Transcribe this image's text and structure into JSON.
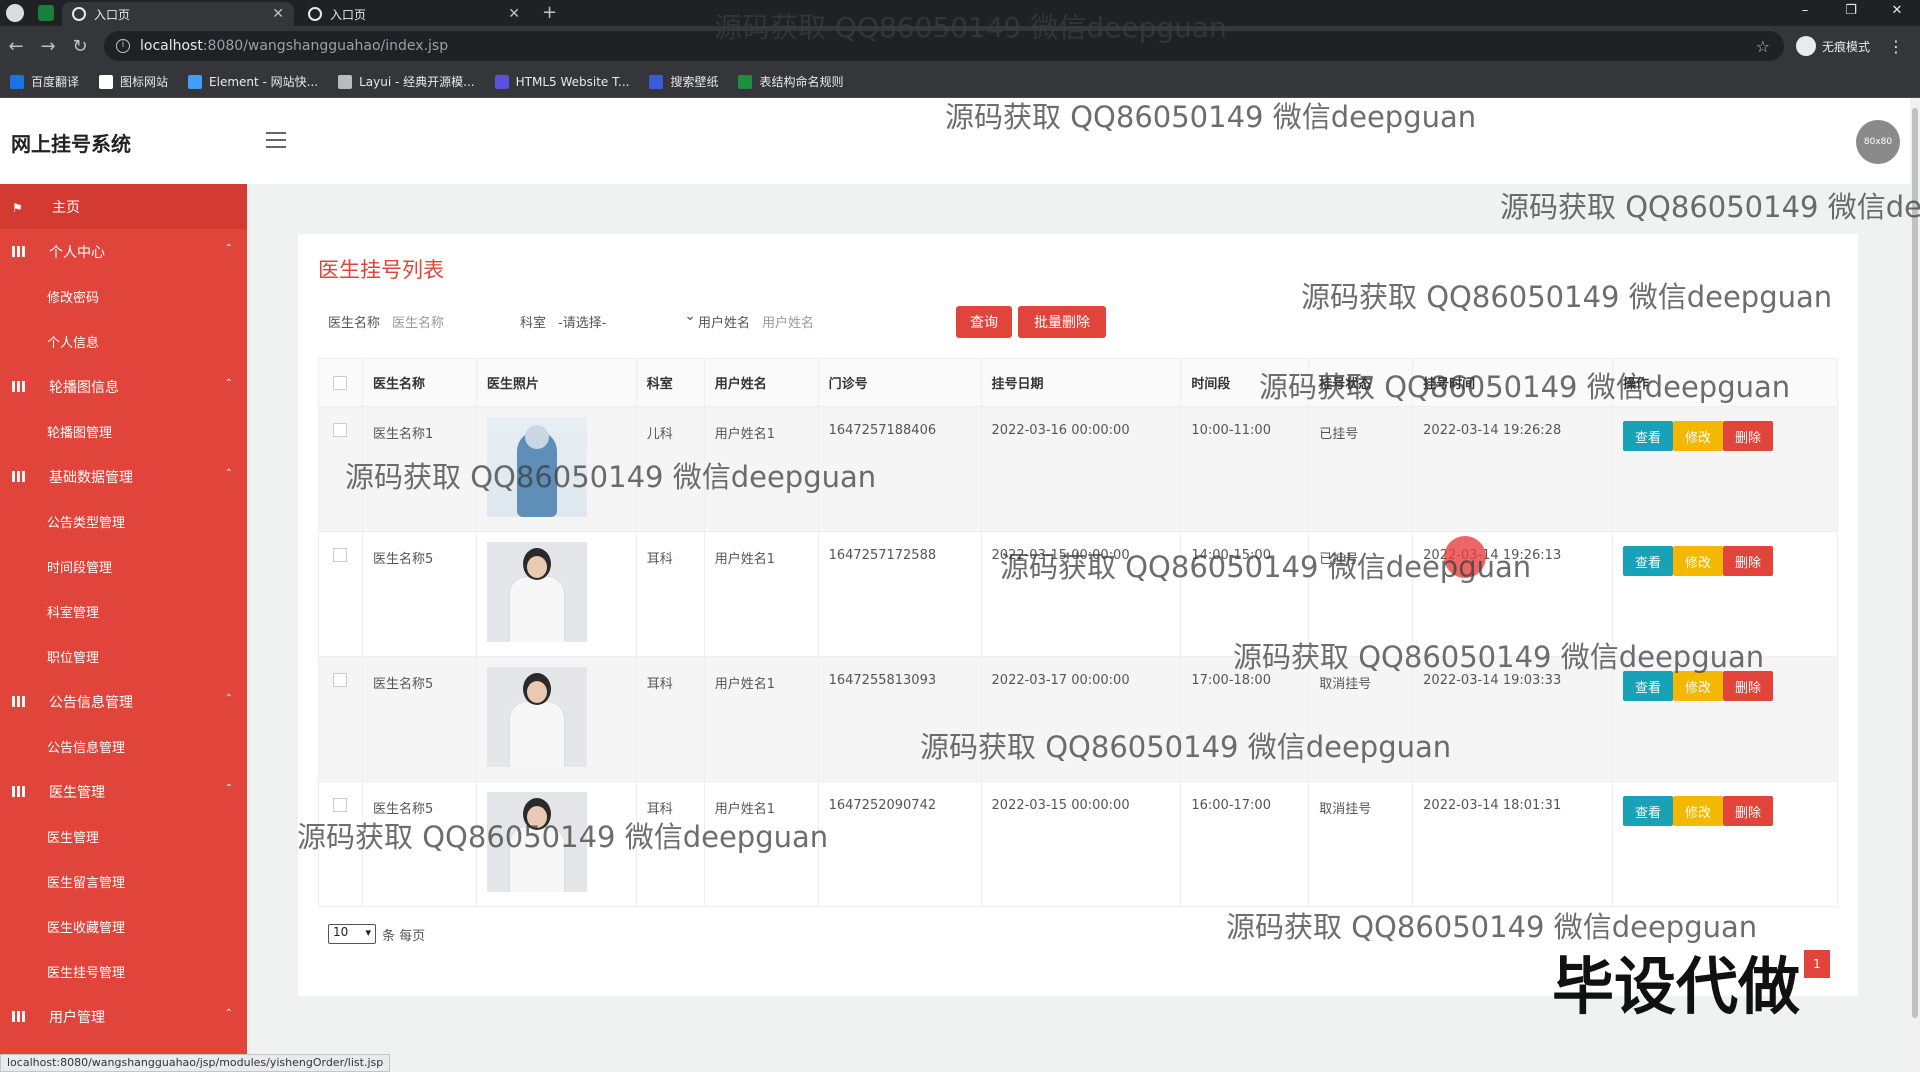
{
  "browser": {
    "tabs": [
      {
        "label": "入口页"
      },
      {
        "label": "入口页"
      }
    ],
    "url_host": "localhost",
    "url_path": ":8080/wangshangguahao/index.jsp",
    "incognito_label": "无痕模式",
    "bookmarks": [
      {
        "label": "百度翻译",
        "color": "#1a73e8"
      },
      {
        "label": "图标网站",
        "color": "#ffffff"
      },
      {
        "label": "Element - 网站快...",
        "color": "#409eff"
      },
      {
        "label": "Layui - 经典开源模...",
        "color": "#bbbbbb"
      },
      {
        "label": "HTML5 Website T...",
        "color": "#5b4fe0"
      },
      {
        "label": "搜索壁纸",
        "color": "#3b5bdb"
      },
      {
        "label": "表结构命名规则",
        "color": "#1e8e3e"
      }
    ],
    "status_url": "localhost:8080/wangshangguahao/jsp/modules/yishengOrder/list.jsp"
  },
  "app": {
    "title": "网上挂号系统",
    "avatar_text": "80x80"
  },
  "sidebar": {
    "home": "主页",
    "groups": [
      {
        "label": "个人中心",
        "children": [
          "修改密码",
          "个人信息"
        ]
      },
      {
        "label": "轮播图信息",
        "children": [
          "轮播图管理"
        ]
      },
      {
        "label": "基础数据管理",
        "children": [
          "公告类型管理",
          "时间段管理",
          "科室管理",
          "职位管理"
        ]
      },
      {
        "label": "公告信息管理",
        "children": [
          "公告信息管理"
        ]
      },
      {
        "label": "医生管理",
        "children": [
          "医生管理",
          "医生留言管理",
          "医生收藏管理",
          "医生挂号管理"
        ]
      },
      {
        "label": "用户管理",
        "children": [
          "用户管理"
        ]
      }
    ]
  },
  "page": {
    "title": "医生挂号列表",
    "filters": {
      "doctor_label": "医生名称",
      "doctor_placeholder": "医生名称",
      "dept_label": "科室",
      "dept_value": "-请选择-",
      "user_label": "用户姓名",
      "user_placeholder": "用户姓名"
    },
    "query_button": "查询",
    "batch_delete_button": "批量删除",
    "columns": [
      "医生名称",
      "医生照片",
      "科室",
      "用户姓名",
      "门诊号",
      "挂号日期",
      "时间段",
      "挂号状态",
      "挂号时间",
      "操作"
    ],
    "rows": [
      {
        "doctor": "医生名称1",
        "dept": "儿科",
        "user": "用户姓名1",
        "clinic_no": "1647257188406",
        "date": "2022-03-16 00:00:00",
        "slot": "10:00-11:00",
        "status": "已挂号",
        "time": "2022-03-14 19:26:28",
        "photo": "nurse"
      },
      {
        "doctor": "医生名称5",
        "dept": "耳科",
        "user": "用户姓名1",
        "clinic_no": "1647257172588",
        "date": "2022-03-15 00:00:00",
        "slot": "14:00-15:00",
        "status": "已挂号",
        "time": "2022-03-14 19:26:13",
        "photo": "doctor"
      },
      {
        "doctor": "医生名称5",
        "dept": "耳科",
        "user": "用户姓名1",
        "clinic_no": "1647255813093",
        "date": "2022-03-17 00:00:00",
        "slot": "17:00-18:00",
        "status": "取消挂号",
        "time": "2022-03-14 19:03:33",
        "photo": "doctor"
      },
      {
        "doctor": "医生名称5",
        "dept": "耳科",
        "user": "用户姓名1",
        "clinic_no": "1647252090742",
        "date": "2022-03-15 00:00:00",
        "slot": "16:00-17:00",
        "status": "取消挂号",
        "time": "2022-03-14 18:01:31",
        "photo": "doctor"
      }
    ],
    "row_actions": {
      "view": "查看",
      "edit": "修改",
      "delete": "删除"
    },
    "page_size": "10",
    "page_size_suffix": "条 每页",
    "current_page": "1"
  },
  "watermarks": {
    "text": "源码获取 QQ86050149 微信deepguan",
    "big": "毕设代做"
  },
  "colors": {
    "accent": "#e0443a",
    "view": "#17a2b8",
    "edit": "#f5b800",
    "delete": "#e0443a"
  }
}
